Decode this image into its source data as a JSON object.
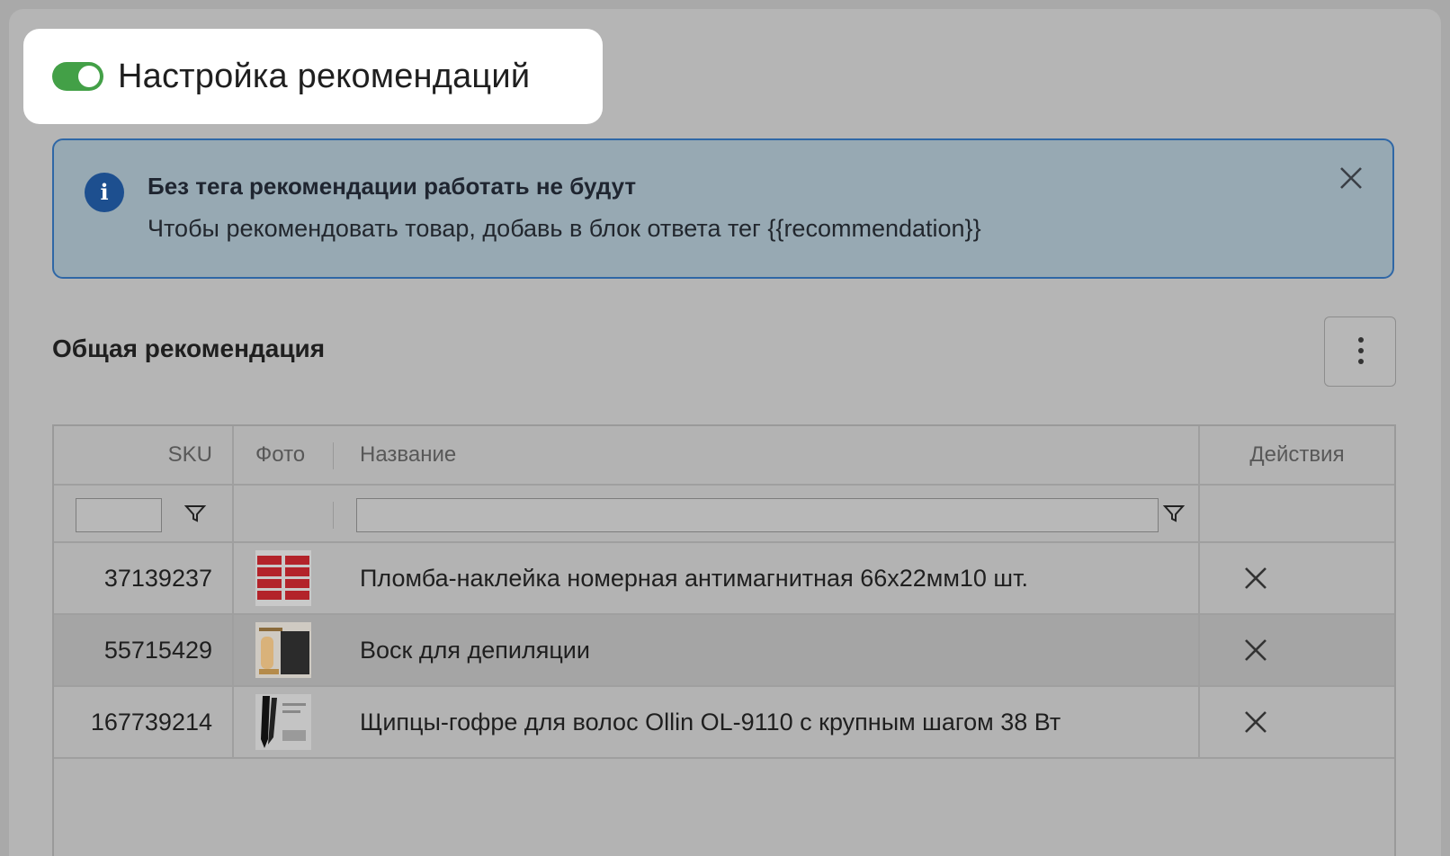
{
  "header": {
    "title": "Настройка рекомендаций",
    "toggle_on": true,
    "toggle_color": "#43a047"
  },
  "alert": {
    "title": "Без тега рекомендации работать не будут",
    "text": "Чтобы рекомендовать товар, добавь в блок ответа тег {{recommendation}}",
    "icon": "info-icon",
    "close_icon": "close-icon"
  },
  "section": {
    "title": "Общая рекомендация",
    "more_icon": "more-vertical-icon"
  },
  "table": {
    "columns": {
      "sku": "SKU",
      "photo": "Фото",
      "name": "Название",
      "actions": "Действия"
    },
    "filters": {
      "sku_value": "",
      "name_value": ""
    },
    "rows": [
      {
        "sku": "37139237",
        "name": "Пломба-наклейка номерная антимагнитная 66х22мм10 шт.",
        "action": "×"
      },
      {
        "sku": "55715429",
        "name": "Воск для депиляции",
        "action": "×"
      },
      {
        "sku": "167739214",
        "name": "Щипцы-гофре для волос Ollin OL-9110 с крупным шагом 38 Вт",
        "action": "×"
      }
    ]
  }
}
